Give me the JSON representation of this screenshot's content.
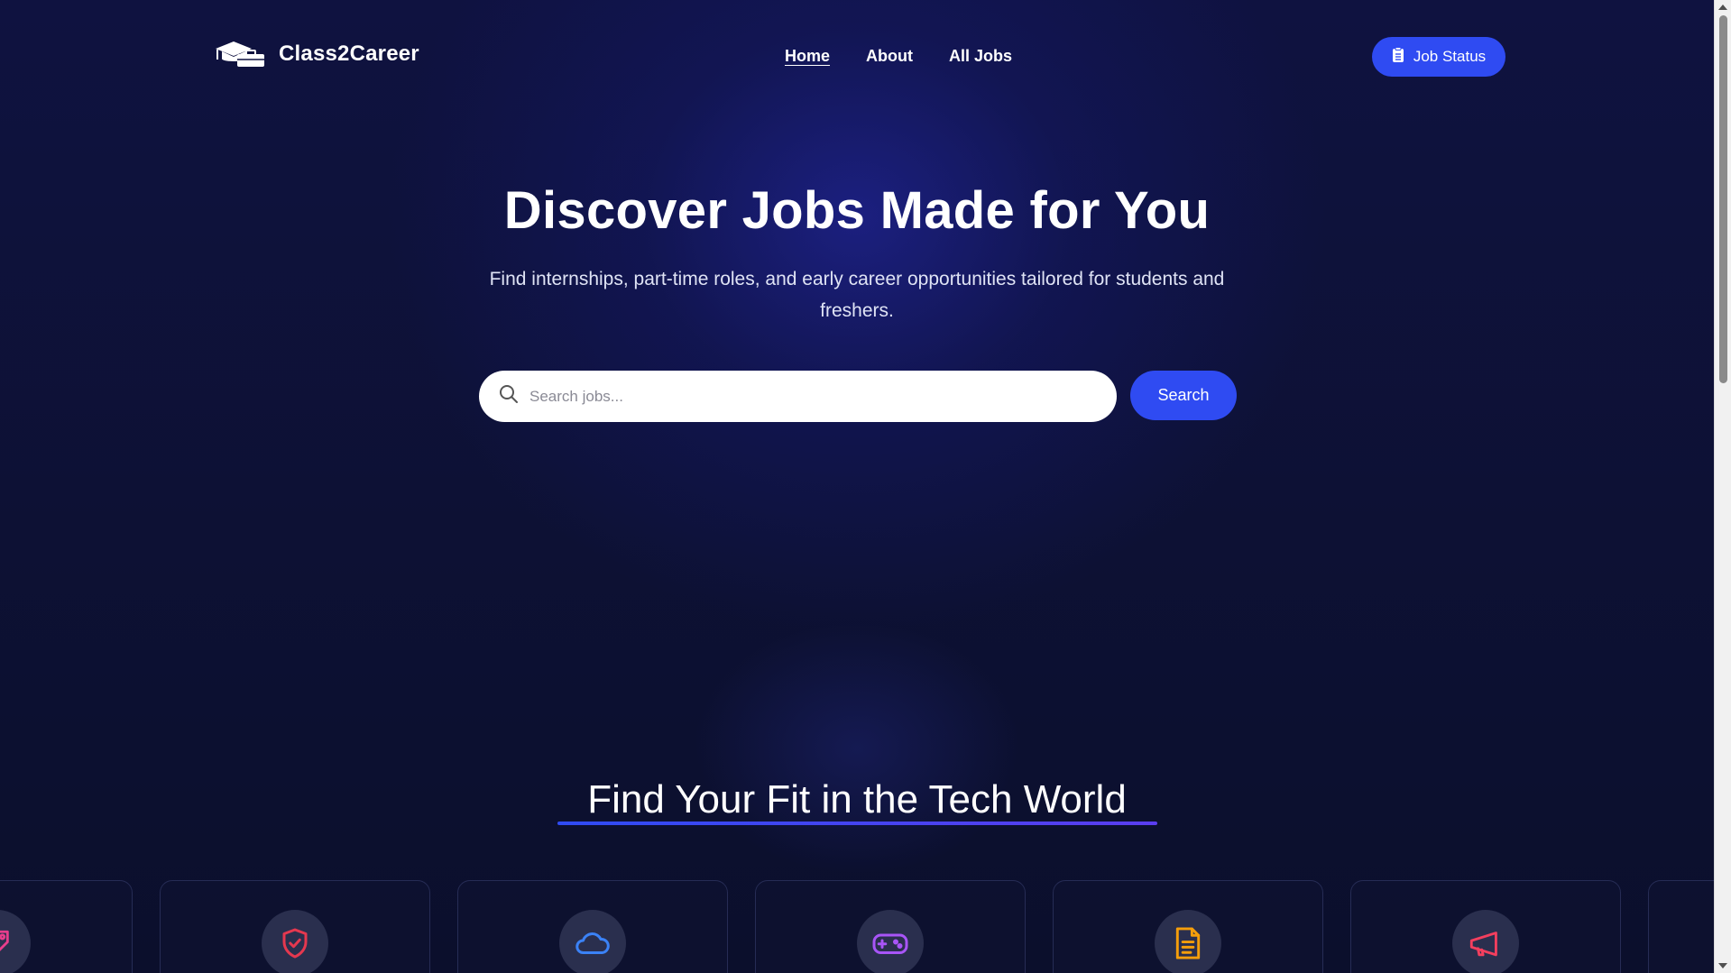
{
  "nav": {
    "brand": "Class2Career",
    "links": [
      {
        "label": "Home",
        "active": true
      },
      {
        "label": "About",
        "active": false
      },
      {
        "label": "All Jobs",
        "active": false
      }
    ],
    "status_button": "Job Status"
  },
  "hero": {
    "title": "Discover Jobs Made for You",
    "subtitle": "Find internships, part-time roles, and early career opportunities tailored for students and freshers.",
    "search_placeholder": "Search jobs...",
    "search_button": "Search"
  },
  "categories": {
    "title": "Find Your Fit in the Tech World",
    "cards": [
      {
        "icon": "tag-icon",
        "color": "#e83e8c"
      },
      {
        "icon": "shield-check-icon",
        "color": "#e5384f"
      },
      {
        "icon": "cloud-icon",
        "color": "#3b82f6"
      },
      {
        "icon": "gamepad-icon",
        "color": "#a855f7"
      },
      {
        "icon": "document-icon",
        "color": "#f59e0b"
      },
      {
        "icon": "megaphone-icon",
        "color": "#f43f5e"
      }
    ]
  },
  "colors": {
    "accent": "#2f4bf2",
    "background": "#0d1134"
  }
}
